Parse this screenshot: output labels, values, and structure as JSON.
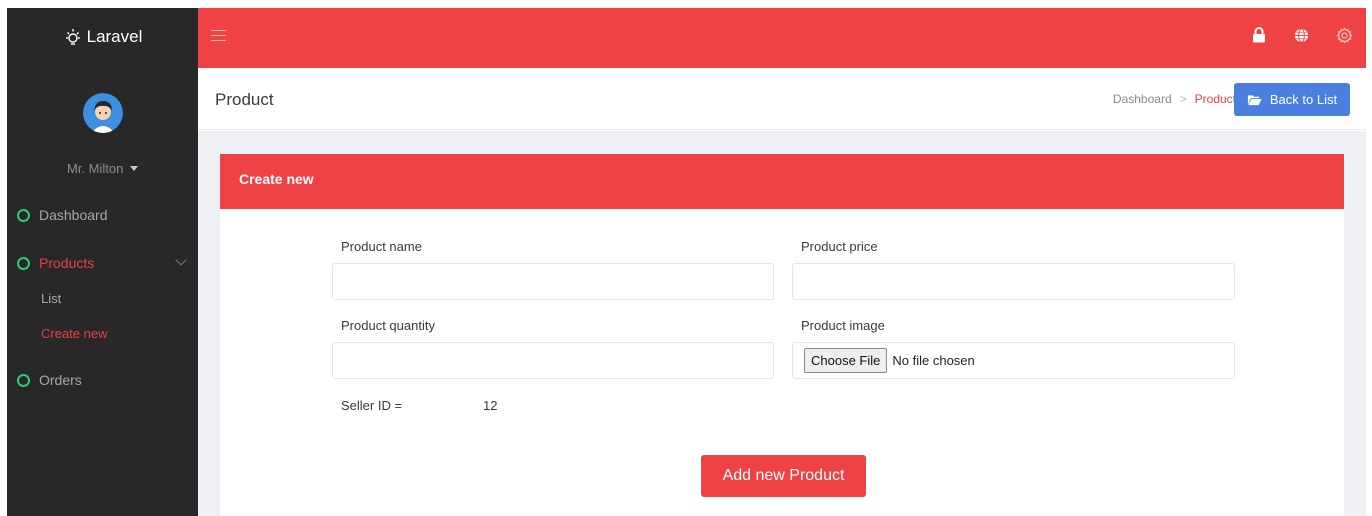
{
  "brand": {
    "name": "Laravel",
    "icon": "bulb-icon"
  },
  "user": {
    "name": "Mr. Milton"
  },
  "sidebar": {
    "items": [
      {
        "label": "Dashboard"
      },
      {
        "label": "Products",
        "sub": [
          {
            "label": "List"
          },
          {
            "label": "Create new"
          }
        ]
      },
      {
        "label": "Orders"
      }
    ]
  },
  "topbar": {
    "icons": [
      "menu-icon",
      "lock-icon",
      "globe-icon",
      "gear-icon"
    ]
  },
  "header": {
    "title": "Product",
    "breadcrumb": [
      "Dashboard",
      "Product"
    ],
    "back_button": "Back to List"
  },
  "form": {
    "title": "Create new",
    "fields": {
      "name_label": "Product name",
      "price_label": "Product price",
      "quantity_label": "Product quantity",
      "image_label": "Product image"
    },
    "values": {
      "name": "",
      "price": "",
      "quantity": ""
    },
    "file": {
      "button": "Choose File",
      "status": "No file chosen"
    },
    "seller": {
      "label": "Seller ID =",
      "value": "12"
    },
    "submit": "Add new Product"
  },
  "colors": {
    "primary": "#ef4244",
    "sidebar": "#282828",
    "accent_blue": "#4a7fe0",
    "nav_circle": "#2ecc71"
  }
}
